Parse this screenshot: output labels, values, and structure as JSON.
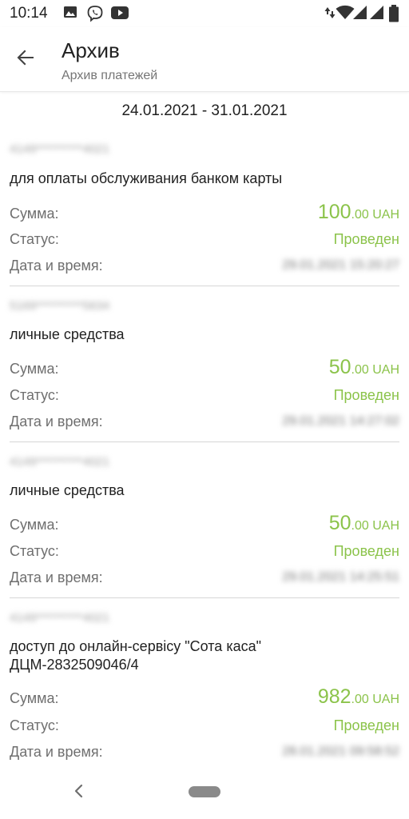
{
  "status_bar": {
    "time": "10:14",
    "left_icons": [
      "gallery-icon",
      "viber-icon",
      "youtube-icon"
    ],
    "right_icons": [
      "data-arrows-icon",
      "wifi-icon",
      "signal-icon",
      "signal-icon",
      "battery-icon"
    ]
  },
  "app_bar": {
    "title": "Архив",
    "subtitle": "Архив платежей"
  },
  "date_range": "24.01.2021 - 31.01.2021",
  "labels": {
    "amount": "Сумма:",
    "status": "Статус:",
    "datetime": "Дата и время:"
  },
  "payments": [
    {
      "card": "4149**********4021",
      "purpose": "для оплаты обслуживания банком карты",
      "amount_int": "100",
      "amount_frac": ".00 UAH",
      "status": "Проведен",
      "datetime": "29.01.2021 15:20:27"
    },
    {
      "card": "5169**********5634",
      "purpose": "личные средства",
      "amount_int": "50",
      "amount_frac": ".00 UAH",
      "status": "Проведен",
      "datetime": "29.01.2021 14:27:02"
    },
    {
      "card": "4149**********4021",
      "purpose": "личные средства",
      "amount_int": "50",
      "amount_frac": ".00 UAH",
      "status": "Проведен",
      "datetime": "29.01.2021 14:25:51"
    },
    {
      "card": "4149**********4021",
      "purpose": "доступ до онлайн-сервiсу \"Сота каса\"\nДЦМ-2832509046/4",
      "amount_int": "982",
      "amount_frac": ".00 UAH",
      "status": "Проведен",
      "datetime": "28.01.2021 09:58:52"
    }
  ],
  "colors": {
    "accent_green": "#8bc34a",
    "label_gray": "#6f6f6f",
    "divider": "#d6d6d6"
  },
  "nav_bar": {
    "back_icon": "nav-back-icon",
    "home_icon": "home-pill-icon"
  }
}
